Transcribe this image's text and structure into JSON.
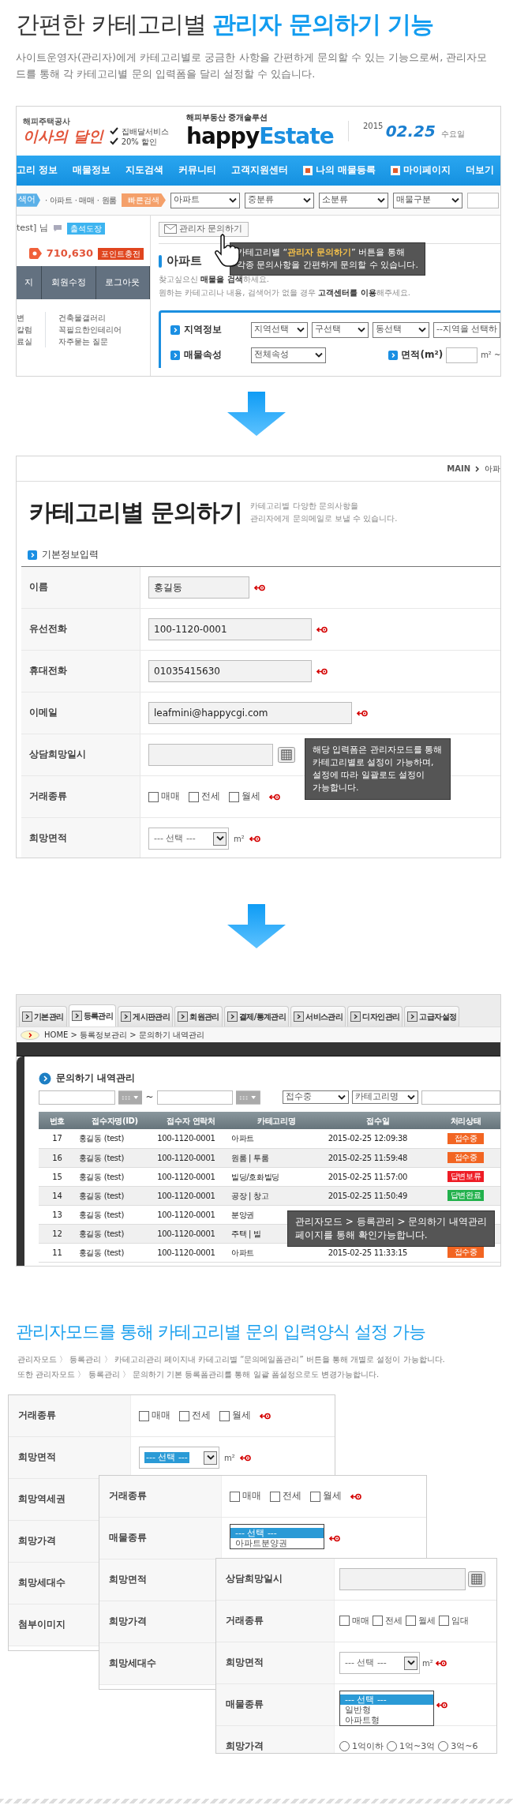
{
  "headline": "간편한 카테고리별 **관리자 문의하기 기능**",
  "description": "사이트운영자(관리자)에게 카테고리별로 궁금한 사항을 간편하게 문의할 수 있는 기능으로써, 관리자모드를 통해 각 카테고리별 문의 입력폼을 달리 설정할 수 있습니다.",
  "site_screen": {
    "promo": {
      "company": "해피주택공사",
      "slogan": "이사의 달인",
      "perks": [
        "집배달서비스",
        "20% 할인"
      ]
    },
    "brand": {
      "tagline": "해피부동산 중개솔루션",
      "word": "happy",
      "word_accent": "Estate"
    },
    "date": {
      "year": "2015",
      "day": "02.25",
      "weekday": "수요일"
    },
    "nav": [
      {
        "label": "고리 정보",
        "kind": "plain"
      },
      {
        "label": "매물정보",
        "kind": "plain"
      },
      {
        "label": "지도검색",
        "kind": "plain"
      },
      {
        "label": "커뮤니티",
        "kind": "plain"
      },
      {
        "label": "고객지원센터",
        "kind": "plain"
      },
      {
        "label": "나의 매물등록",
        "kind": "icon"
      },
      {
        "label": "마이페이지",
        "kind": "icon"
      },
      {
        "label": "더보기",
        "kind": "plain"
      }
    ],
    "quick": {
      "tag": "색어",
      "path": "· 아파트 · 매매 · 원룸",
      "button": "빠른검색",
      "selects": [
        "아파트",
        "중분류",
        "소분류",
        "매물구분"
      ]
    },
    "user": {
      "name": "test] 님",
      "stamp": "출석도장",
      "points": "710,630",
      "charge": "포인트충전",
      "buttons": [
        "지",
        "회원수정",
        "로그아웃"
      ],
      "links": [
        [
          "변",
          "칼럼",
          "료실"
        ],
        [
          "건축물갤러리",
          "꼭필요한인테리어",
          "자주묻는 질문"
        ]
      ]
    },
    "ask_button": "관리자 문의하기",
    "tooltip": [
      "카테고리별 “**관리자 문의하기**” 버튼을 통해",
      "각종 문의사항을 간편하게 문의할 수 있습니다."
    ],
    "heading": "아파트",
    "help": [
      "찾고싶으신 **매물을 검색**하세요.",
      "원하는 카테고리나 내용, 검색어가 없을 경우 **고객센터를 이용**해주세요."
    ],
    "search_rows": [
      {
        "label": "지역정보",
        "selects": [
          "지역선택",
          "구선택",
          "동선택"
        ],
        "input": "--지역을 선택하"
      },
      {
        "label": "매물속성",
        "selects": [
          "전체속성"
        ],
        "range_label": "면적(m²)",
        "unit": "m² ~"
      }
    ]
  },
  "form_screen": {
    "breadcrumb": [
      "MAIN",
      "아파"
    ],
    "title": "카테고리별 문의하기",
    "subtitle": [
      "카테고리별 다양한 문의사항을",
      "관리자에게 문의메일로 보낼 수  있습니다."
    ],
    "section": "기본정보입력",
    "rows": [
      {
        "label": "이름",
        "kind": "text",
        "value": "홍길동",
        "required": true
      },
      {
        "label": "유선전화",
        "kind": "text",
        "value": "100-1120-0001",
        "required": true
      },
      {
        "label": "휴대전화",
        "kind": "text",
        "value": "01035415630",
        "required": true
      },
      {
        "label": "이메일",
        "kind": "text",
        "value": "leafmini@happycgi.com",
        "required": true
      },
      {
        "label": "상담희망일시",
        "kind": "date",
        "required": false
      },
      {
        "label": "거래종류",
        "kind": "checks",
        "options": [
          {
            "label": "매매",
            "checked": false
          },
          {
            "label": "전세",
            "checked": false
          },
          {
            "label": "월세",
            "checked": false
          }
        ],
        "required": true
      },
      {
        "label": "희망면적",
        "kind": "select",
        "value": "--- 선택 ---",
        "highlighted": false,
        "unit": "m²",
        "required": true
      }
    ],
    "tooltip": [
      "해당 입력폼은 관리자모드를 통해",
      "카테고리별로 설정이 가능하며,",
      "설정에 따라 일괄로도 설정이",
      "가능합니다."
    ]
  },
  "admin_screen": {
    "tabs": [
      {
        "label": "기본관리",
        "selected": false
      },
      {
        "label": "등록관리",
        "selected": true
      },
      {
        "label": "게시판관리",
        "selected": false
      },
      {
        "label": "회원관리",
        "selected": false
      },
      {
        "label": "결제/통계관리",
        "selected": false
      },
      {
        "label": "서비스관리",
        "selected": false
      },
      {
        "label": "디자인관리",
        "selected": false
      },
      {
        "label": "고급자설정",
        "selected": false
      }
    ],
    "breadcrumb": "HOME > 등록정보관리 > 문의하기 내역관리",
    "title": "문의하기 내역관리",
    "range_sep": "~",
    "filters": [
      "접수중",
      "카테고리명"
    ],
    "columns": [
      "번호",
      "접수자명(ID)",
      "접수자 연락처",
      "카테고리명",
      "접수일",
      "처리상태"
    ],
    "rows": [
      {
        "cells": [
          "17",
          "홍길동 (test)",
          "100-1120-0001",
          "아파트",
          "2015-02-25 12:09:38"
        ],
        "status": "접수중",
        "color": "#f26522"
      },
      {
        "cells": [
          "16",
          "홍길동 (test)",
          "100-1120-0001",
          "원룸 | 투룸",
          "2015-02-25 11:59:48"
        ],
        "status": "접수중",
        "color": "#f26522"
      },
      {
        "cells": [
          "15",
          "홍길동 (test)",
          "100-1120-0001",
          "빌딩/호화빌딩",
          "2015-02-25 11:57:00"
        ],
        "status": "답변보류",
        "color": "#ee1c25"
      },
      {
        "cells": [
          "14",
          "홍길동 (test)",
          "100-1120-0001",
          "공장 | 창고",
          "2015-02-25 11:50:49"
        ],
        "status": "답변완료",
        "color": "#22b14c"
      },
      {
        "cells": [
          "13",
          "홍길동 (test)",
          "100-1120-0001",
          "분양권",
          null
        ],
        "status": null,
        "color": null
      },
      {
        "cells": [
          "12",
          "홍길동 (test)",
          "100-1120-0001",
          "주택 | 빌",
          null
        ],
        "status": null,
        "color": null
      },
      {
        "cells": [
          "11",
          "홍길동 (test)",
          "100-1120-0001",
          "아파트",
          "2015-02-25 11:33:15"
        ],
        "status": "접수중",
        "color": "#f26522"
      }
    ],
    "tooltip": [
      "관리자모드 > 등록관리 > 문의하기 내역관리",
      "페이지를 통해 확인가능합니다."
    ]
  },
  "setup": {
    "title": "관리자모드를 통해 카테고리별 문의 입력양식 설정 가능",
    "lines": [
      "관리자모드 〉 등록관리 〉 카테고리관리 페이지내 카테고리별  “문의메일폼관리” 버튼을 통해 개별로 설정이 가능합니다.",
      "또한 관리자모드 〉 등록관리 〉 문의하기 기본 등록폼관리를 통해 일괄 폼설정으로도 변경가능합니다."
    ],
    "forms": [
      {
        "rows": [
          {
            "label": "거래종류",
            "kind": "checks",
            "options": [
              {
                "label": "매매",
                "checked": false
              },
              {
                "label": "전세",
                "checked": false
              },
              {
                "label": "월세",
                "checked": false
              }
            ],
            "required": true
          },
          {
            "label": "희망면적",
            "kind": "select",
            "value": "--- 선택 ---",
            "highlighted": true,
            "unit": "m²",
            "required": true
          },
          {
            "label": "희망역세권"
          },
          {
            "label": "희망가격"
          },
          {
            "label": "희망세대수"
          },
          {
            "label": "첨부이미지"
          }
        ]
      },
      {
        "rows": [
          {
            "label": "거래종류",
            "kind": "checks",
            "options": [
              {
                "label": "매매",
                "checked": false
              },
              {
                "label": "전세",
                "checked": false
              },
              {
                "label": "월세",
                "checked": false
              }
            ],
            "required": true
          },
          {
            "label": "매물종류",
            "kind": "listbox",
            "options": [
              {
                "label": "--- 선택 ---",
                "selected": true
              },
              {
                "label": "아파트분양권",
                "selected": false
              }
            ],
            "required": true
          },
          {
            "label": "희망면적"
          },
          {
            "label": "희망가격"
          },
          {
            "label": "희망세대수"
          }
        ]
      },
      {
        "rows": [
          {
            "label": "상담희망일시",
            "kind": "date",
            "required": false
          },
          {
            "label": "거래종류",
            "kind": "checks",
            "options": [
              {
                "label": "매매",
                "checked": false
              },
              {
                "label": "전세",
                "checked": false
              },
              {
                "label": "월세",
                "checked": false
              },
              {
                "label": "임대",
                "checked": false
              }
            ],
            "required": false
          },
          {
            "label": "희망면적",
            "kind": "select",
            "value": "--- 선택 ---",
            "highlighted": false,
            "unit": "m²",
            "required": true
          },
          {
            "label": "매물종류",
            "kind": "listbox",
            "options": [
              {
                "label": "--- 선택 ---",
                "selected": true
              },
              {
                "label": "일반형",
                "selected": false
              },
              {
                "label": "아파트형",
                "selected": false
              }
            ],
            "required": true
          },
          {
            "label": "희망가격",
            "kind": "radios",
            "options": [
              {
                "label": "1억이하",
                "selected": false
              },
              {
                "label": "1억~3억",
                "selected": false
              },
              {
                "label": "3억~6",
                "selected": false
              }
            ],
            "required": false
          }
        ]
      }
    ]
  }
}
